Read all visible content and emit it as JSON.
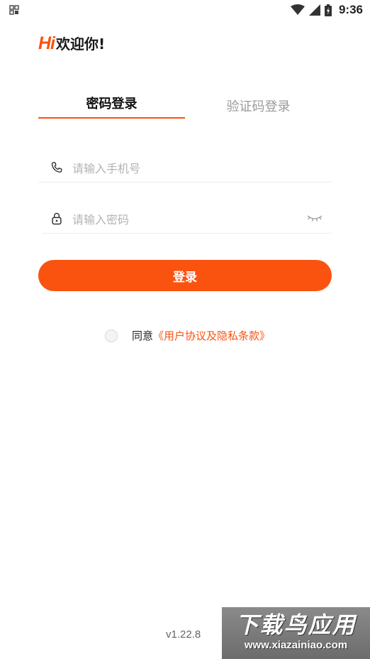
{
  "status_bar": {
    "time": "9:36"
  },
  "header": {
    "hi": "Hi",
    "welcome": "欢迎你!"
  },
  "tabs": [
    {
      "label": "密码登录",
      "active": true
    },
    {
      "label": "验证码登录",
      "active": false
    }
  ],
  "form": {
    "phone_placeholder": "请输入手机号",
    "password_placeholder": "请输入密码",
    "login_label": "登录"
  },
  "agreement": {
    "prefix": "同意",
    "link": "《用户协议及隐私条款》"
  },
  "version": "v1.22.8",
  "watermark": {
    "title": "下载鸟应用",
    "url": "www.xiazainiao.com"
  },
  "colors": {
    "accent": "#fa5310"
  },
  "icons": [
    "app-grid-icon",
    "wifi-icon",
    "signal-icon",
    "battery-icon",
    "phone-icon",
    "lock-icon",
    "eye-closed-icon"
  ]
}
